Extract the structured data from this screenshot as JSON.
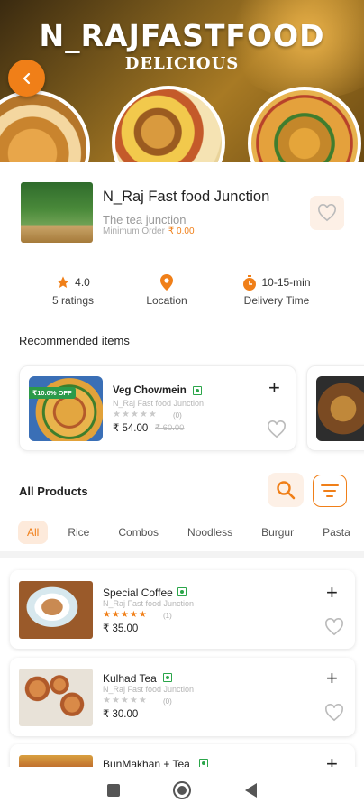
{
  "status_bar": {
    "time": "",
    "battery": ""
  },
  "banner": {
    "title": "N_RAJFASTFOOD",
    "subtitle": "DELICIOUS"
  },
  "restaurant": {
    "name": "N_Raj Fast food Junction",
    "tagline": "The tea junction",
    "min_order_label": "Minimum Order",
    "min_order_value": "₹ 0.00"
  },
  "stats": {
    "rating": "4.0",
    "ratings_label": "5 ratings",
    "location_label": "Location",
    "delivery_time": "10-15-min",
    "delivery_label": "Delivery Time"
  },
  "recommended": {
    "title": "Recommended items",
    "items": [
      {
        "name": "Veg Chowmein",
        "restaurant": "N_Raj Fast food Junction",
        "stars": "★★★★★",
        "rating_count": "(0)",
        "price": "₹ 54.00",
        "old_price": "₹ 60.00",
        "badge": "₹10.0% OFF"
      }
    ]
  },
  "all_products": {
    "title": "All Products",
    "categories": [
      "All",
      "Rice",
      "Combos",
      "Noodless",
      "Burgur",
      "Pasta"
    ],
    "items": [
      {
        "name": "Special Coffee",
        "restaurant": "N_Raj Fast food Junction",
        "stars": "★★★★★",
        "rating_count": "(1)",
        "price": "₹ 35.00"
      },
      {
        "name": "Kulhad Tea",
        "restaurant": "N_Raj Fast food Junction",
        "stars": "★★★★★",
        "rating_count": "(0)",
        "price": "₹ 30.00"
      },
      {
        "name": "BunMakhan + Tea",
        "restaurant": "",
        "stars": "",
        "rating_count": "",
        "price": ""
      }
    ]
  },
  "colors": {
    "accent": "#f07f18",
    "veg": "#2ba64a",
    "light_accent": "#fdf0e6"
  }
}
